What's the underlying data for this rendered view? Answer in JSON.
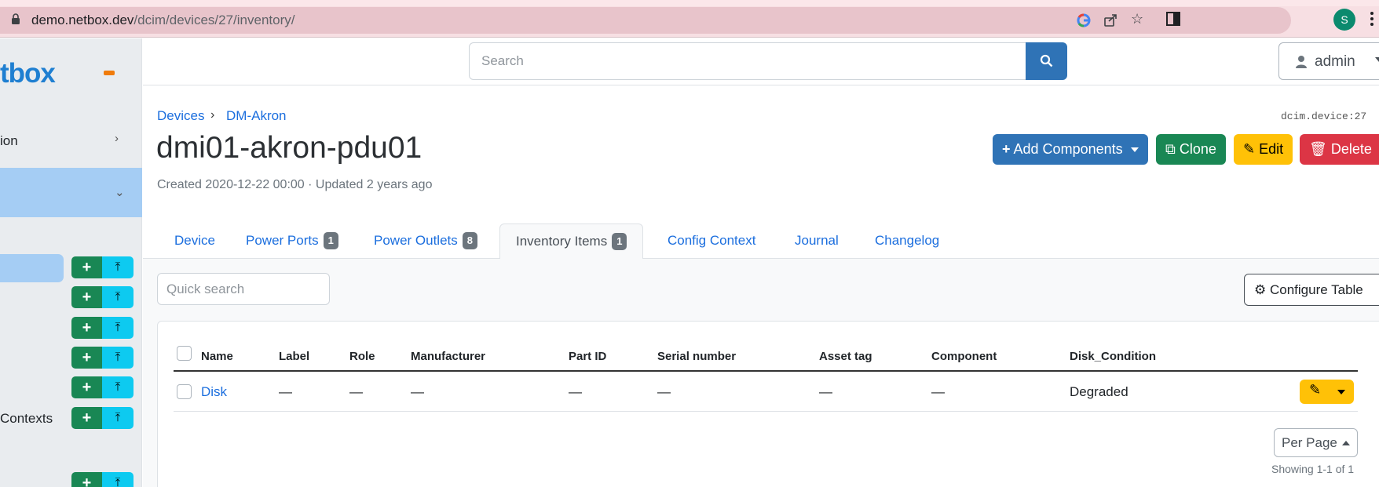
{
  "browser": {
    "url_host": "demo.netbox.dev",
    "url_path": "/dcim/devices/27/inventory/",
    "profile_initial": "S",
    "icons": [
      "lock-icon",
      "google-icon",
      "share-icon",
      "star-icon",
      "sidebar-toggle-icon",
      "profile-icon",
      "menu-dots-icon"
    ]
  },
  "sidebar": {
    "logo": "tbox",
    "items": [
      {
        "label": "ion"
      },
      {
        "label": ""
      },
      {
        "label": "Contexts"
      }
    ]
  },
  "topbar": {
    "search_placeholder": "Search",
    "user": "admin"
  },
  "page": {
    "breadcrumbs": [
      "Devices",
      "DM-Akron"
    ],
    "object_type": "dcim.device:27",
    "title": "dmi01-akron-pdu01",
    "meta": "Created 2020-12-22 00:00 · Updated 2 years ago",
    "buttons": {
      "add": "Add Components",
      "clone": "Clone",
      "edit": "Edit",
      "delete": "Delete"
    }
  },
  "tabs": [
    {
      "label": "Device"
    },
    {
      "label": "Power Ports",
      "badge": "1"
    },
    {
      "label": "Power Outlets",
      "badge": "8"
    },
    {
      "label": "Inventory Items",
      "badge": "1",
      "active": true
    },
    {
      "label": "Config Context"
    },
    {
      "label": "Journal"
    },
    {
      "label": "Changelog"
    }
  ],
  "toolbar": {
    "quick_search_placeholder": "Quick search",
    "configure_label": "Configure Table"
  },
  "table": {
    "columns": [
      "Name",
      "Label",
      "Role",
      "Manufacturer",
      "Part ID",
      "Serial number",
      "Asset tag",
      "Component",
      "Disk_Condition"
    ],
    "rows": [
      {
        "name": "Disk",
        "label": "—",
        "role": "—",
        "manufacturer": "—",
        "part_id": "—",
        "serial": "—",
        "asset_tag": "—",
        "component": "—",
        "disk_condition": "Degraded"
      }
    ]
  },
  "footer": {
    "per_page": "Per Page",
    "showing": "Showing 1-1 of 1"
  },
  "colors": {
    "primary": "#2f73b6",
    "success": "#198754",
    "warning": "#ffc107",
    "danger": "#dc3545",
    "info": "#0dcaf0",
    "link": "#1b6ede"
  }
}
